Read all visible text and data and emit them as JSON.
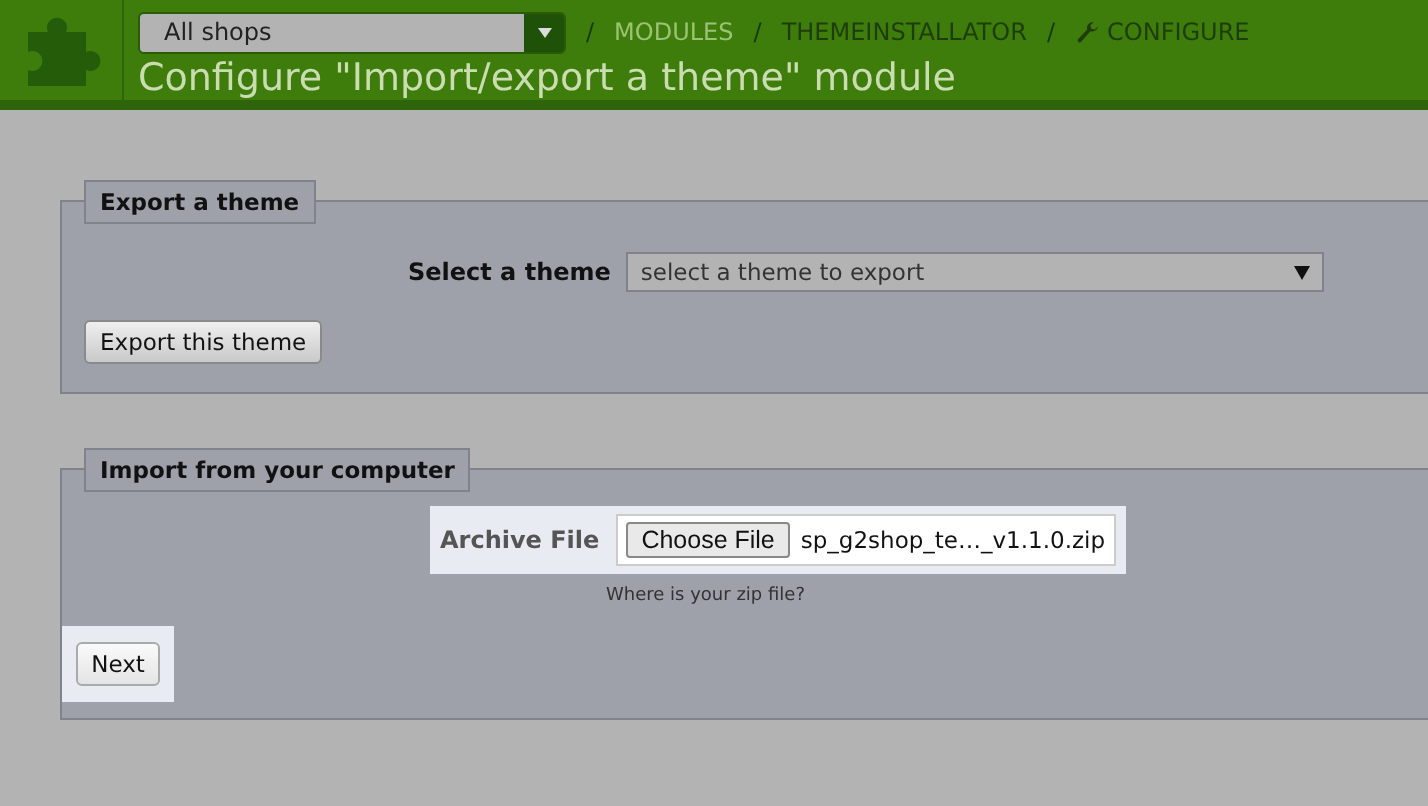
{
  "header": {
    "shop_selector": {
      "value": "All shops"
    },
    "breadcrumbs": [
      {
        "separator": "/",
        "label": "MODULES",
        "kind": "link"
      },
      {
        "separator": "/",
        "label": "THEMEINSTALLATOR",
        "kind": "text"
      },
      {
        "separator": "/",
        "label": "CONFIGURE",
        "kind": "current"
      }
    ],
    "title": "Configure \"Import/export a theme\" module"
  },
  "export_panel": {
    "legend": "Export a theme",
    "field_label": "Select a theme",
    "select": {
      "value": "select a theme to export"
    },
    "button": "Export this theme"
  },
  "import_panel": {
    "legend": "Import from your computer",
    "field_label": "Archive File",
    "file_button": "Choose File",
    "file_name": "sp_g2shop_te…_v1.1.0.zip",
    "help": "Where is your zip file?",
    "button": "Next"
  }
}
